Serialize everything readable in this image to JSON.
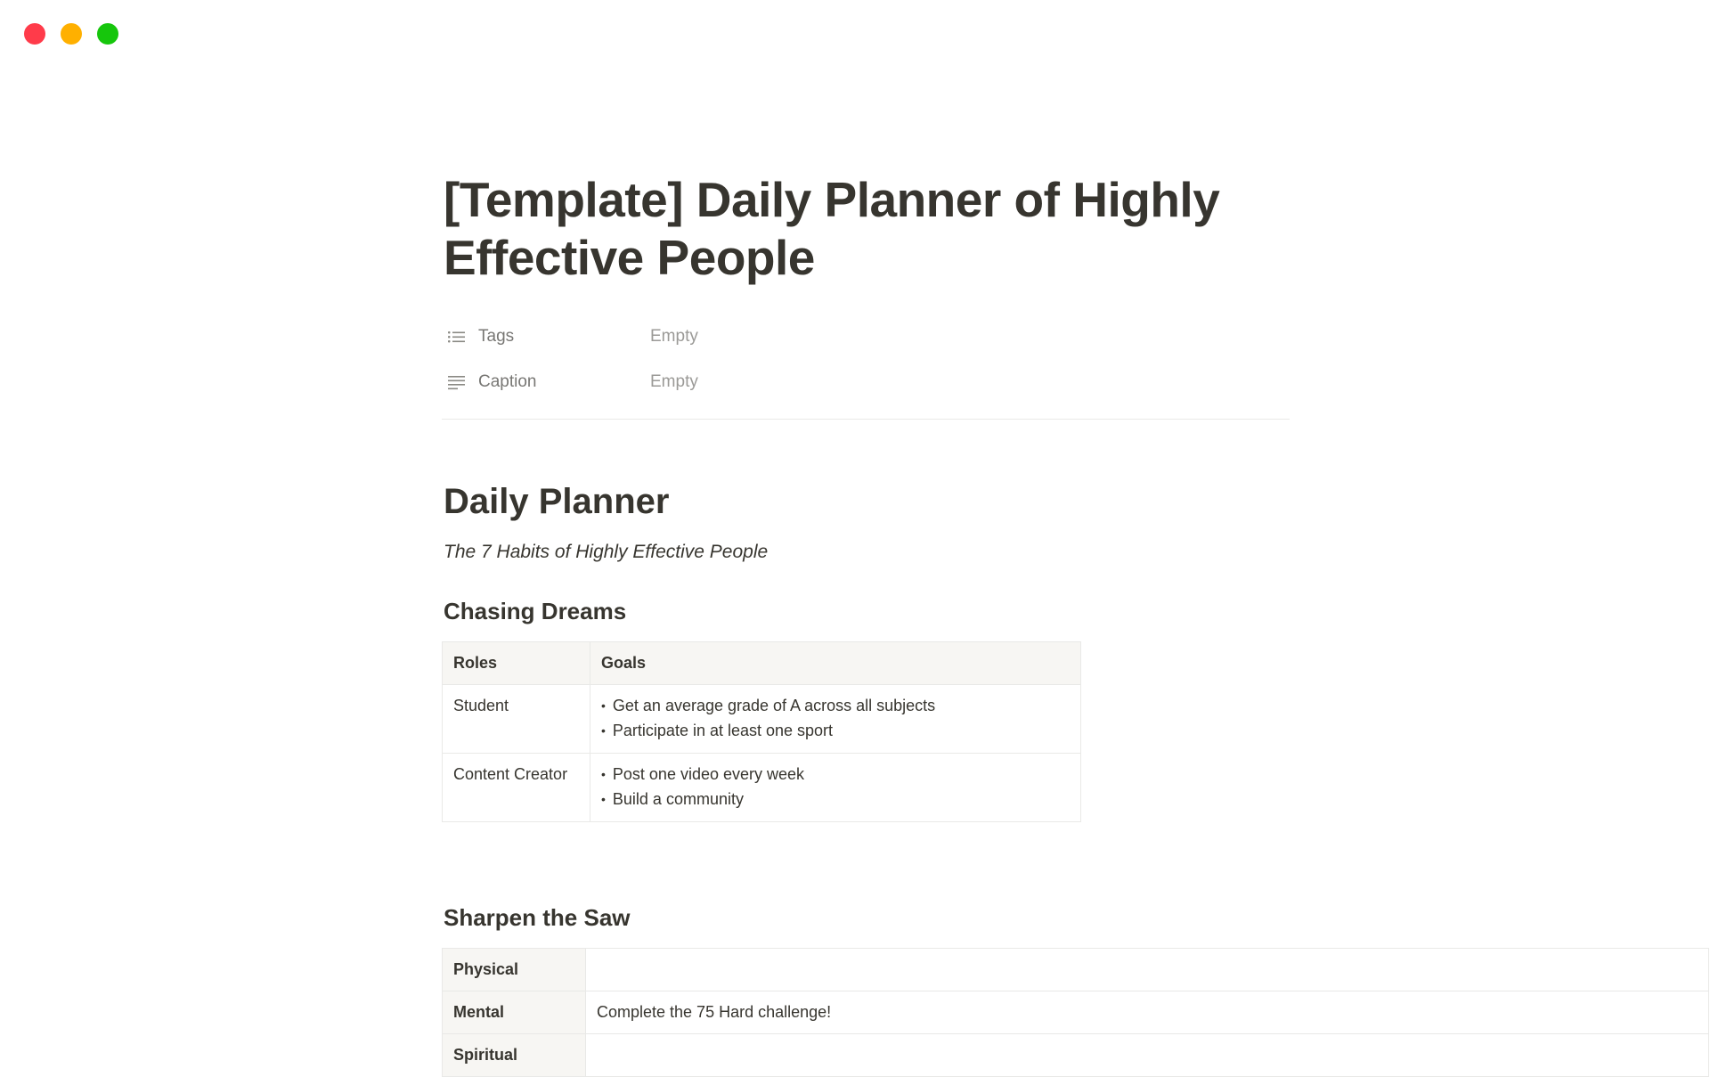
{
  "window": {
    "traffic_lights": {
      "close_color": "#ff3b4a",
      "minimize_color": "#ffb000",
      "zoom_color": "#16c60c"
    }
  },
  "page": {
    "title": "[Template] Daily Planner of Highly Effective People",
    "properties": [
      {
        "icon": "list-icon",
        "name": "Tags",
        "value": "Empty"
      },
      {
        "icon": "text-lines-icon",
        "name": "Caption",
        "value": "Empty"
      }
    ]
  },
  "content": {
    "heading": "Daily Planner",
    "subtitle": "The 7 Habits of Highly Effective People",
    "chasing_dreams": {
      "heading": "Chasing Dreams",
      "columns": [
        "Roles",
        "Goals"
      ],
      "rows": [
        {
          "role": "Student",
          "goals": [
            "Get an average grade of A across all subjects",
            "Participate in at least one sport"
          ]
        },
        {
          "role": "Content Creator",
          "goals": [
            "Post one video every week",
            "Build a community"
          ]
        }
      ]
    },
    "sharpen_the_saw": {
      "heading": "Sharpen the Saw",
      "rows": [
        {
          "label": "Physical",
          "value": ""
        },
        {
          "label": "Mental",
          "value": "Complete the 75 Hard challenge!"
        },
        {
          "label": "Spiritual",
          "value": ""
        }
      ]
    }
  }
}
